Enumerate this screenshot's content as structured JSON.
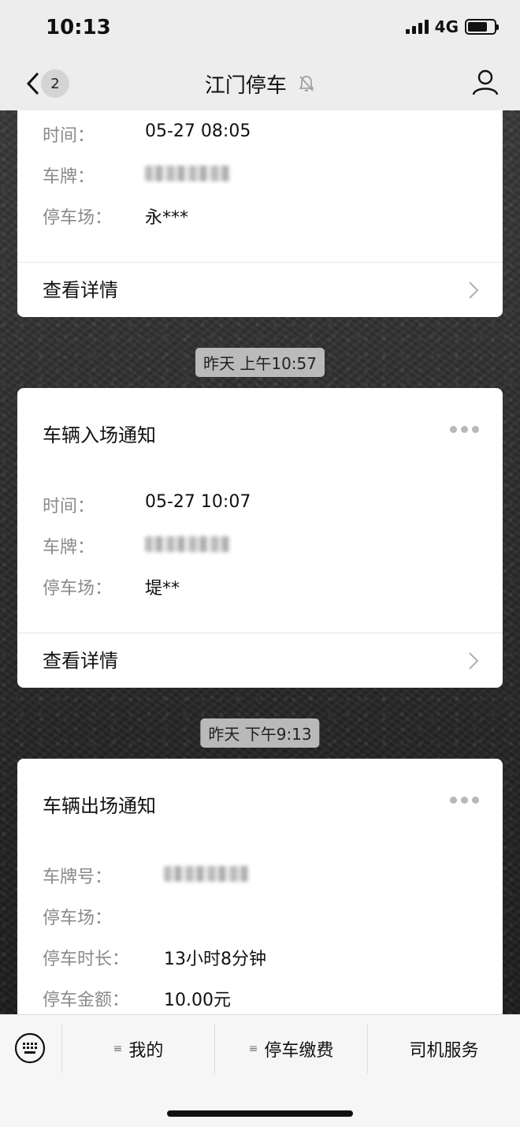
{
  "status": {
    "time": "10:13",
    "network": "4G"
  },
  "nav": {
    "back_count": "2",
    "title": "江门停车"
  },
  "cards": [
    {
      "rows": [
        {
          "k": "时间：",
          "v": "05-27 08:05"
        },
        {
          "k": "车牌：",
          "v": ""
        },
        {
          "k": "停车场：",
          "v": "永***"
        }
      ],
      "detail": "查看详情"
    },
    {
      "time_chip": "昨天 上午10:57",
      "title": "车辆入场通知",
      "rows": [
        {
          "k": "时间：",
          "v": "05-27 10:07"
        },
        {
          "k": "车牌：",
          "v": ""
        },
        {
          "k": "停车场：",
          "v": "堤**"
        }
      ],
      "detail": "查看详情"
    },
    {
      "time_chip": "昨天 下午9:13",
      "title": "车辆出场通知",
      "rows": [
        {
          "k": "车牌号：",
          "v": ""
        },
        {
          "k": "停车场：",
          "v": ""
        },
        {
          "k": "停车时长：",
          "v": "13小时8分钟"
        },
        {
          "k": "停车金额：",
          "v": "10.00元"
        }
      ]
    }
  ],
  "menu": {
    "items": [
      {
        "label": "我的",
        "has_submenu": true
      },
      {
        "label": "停车缴费",
        "has_submenu": true
      },
      {
        "label": "司机服务",
        "has_submenu": false
      }
    ]
  },
  "icons": {
    "back": "chevron-left-icon",
    "mute": "bell-mute-icon",
    "user": "user-icon",
    "keyboard": "keyboard-icon",
    "more": "more-dots-icon",
    "chevron": "chevron-right-icon"
  }
}
